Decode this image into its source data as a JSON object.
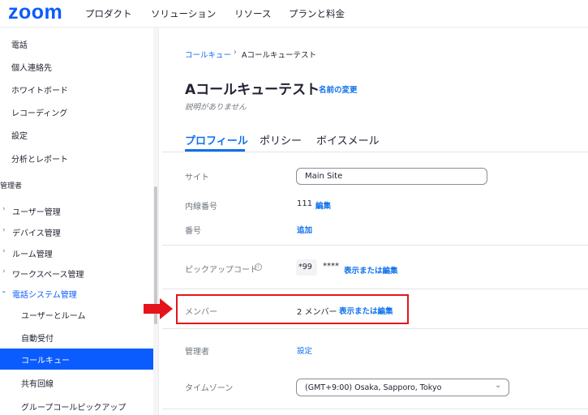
{
  "brand": "zoom",
  "topnav": [
    "プロダクト",
    "ソリューション",
    "リソース",
    "プランと料金"
  ],
  "sidebar": {
    "items": [
      "電話",
      "個人連絡先",
      "ホワイトボード",
      "レコーディング",
      "設定",
      "分析とレポート"
    ],
    "admin_header": "管理者",
    "admin_items": [
      "ユーザー管理",
      "デバイス管理",
      "ルーム管理",
      "ワークスペース管理",
      "電話システム管理"
    ],
    "phone_sub_items": [
      "ユーザーとルーム",
      "自動受付",
      "コールキュー",
      "共有回線",
      "グループコールピックアップ"
    ]
  },
  "breadcrumb": {
    "parent": "コールキュー",
    "separator": "›",
    "current": "Aコールキューテスト"
  },
  "page": {
    "title": "Aコールキューテスト",
    "rename": "名前の変更",
    "description": "説明がありません"
  },
  "tabs": [
    "プロフィール",
    "ポリシー",
    "ボイスメール"
  ],
  "fields": {
    "site": {
      "label": "サイト",
      "value": "Main Site"
    },
    "extension": {
      "label": "内線番号",
      "value": "111",
      "action": "編集"
    },
    "number": {
      "label": "番号",
      "action": "追加"
    },
    "pickup_code": {
      "label": "ピックアップコード",
      "prefix": "*99",
      "masked": "****",
      "action": "表示または編集",
      "info_icon": "i"
    },
    "members": {
      "label": "メンバー",
      "value": "2 メンバー",
      "action": "表示または編集"
    },
    "admin": {
      "label": "管理者",
      "action": "設定"
    },
    "timezone": {
      "label": "タイムゾーン",
      "value": "(GMT+9:00) Osaka, Sapporo, Tokyo"
    }
  },
  "colors": {
    "accent": "#0b5cff",
    "link": "#0e71eb",
    "highlight": "#e5141b"
  }
}
